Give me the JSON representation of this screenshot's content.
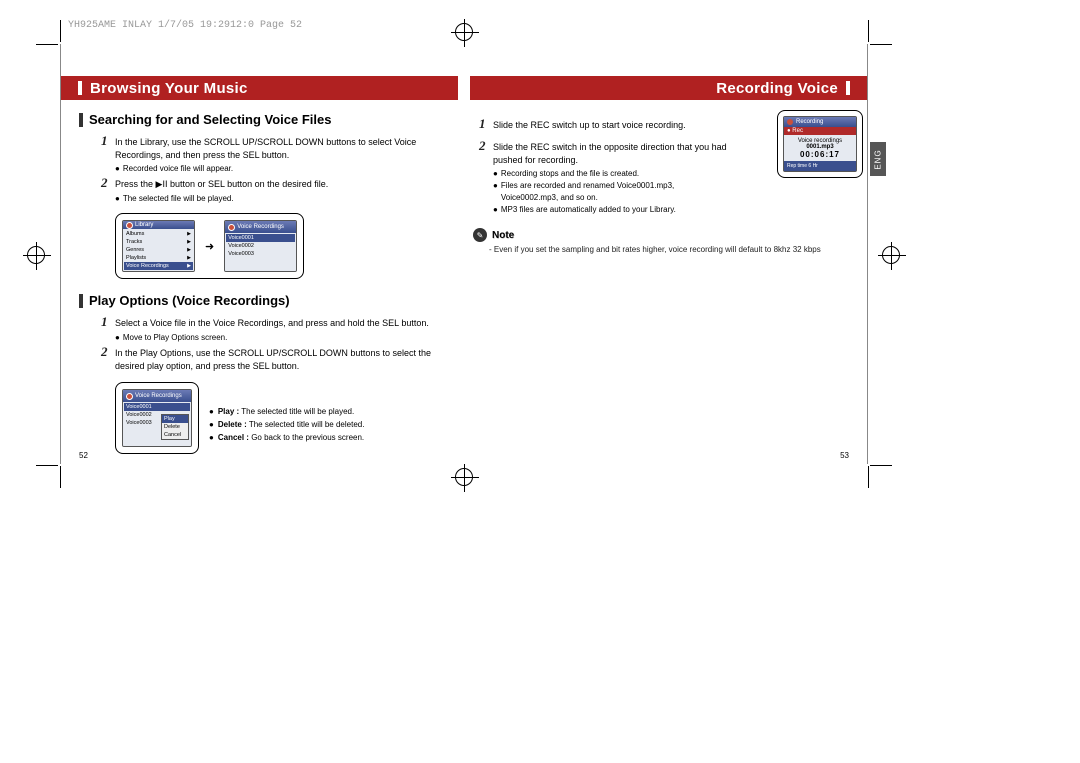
{
  "header_info": "YH925AME INLAY  1/7/05 19:2912:0  Page 52",
  "left": {
    "title": "Browsing Your Music",
    "section1": {
      "title": "Searching for and Selecting Voice Files",
      "step1_num": "1",
      "step1_txt": "In the Library, use the SCROLL UP/SCROLL DOWN buttons to select Voice Recordings, and then press the SEL button.",
      "step1_b1": "Recorded voice file will appear.",
      "step2_num": "2",
      "step2_txt": "Press the ▶II button or SEL button on the desired file.",
      "step2_b1": "The selected file will be played.",
      "lcd1": {
        "title": "Library",
        "rows": [
          "Albums",
          "Tracks",
          "Genres",
          "Playlists"
        ],
        "hl": "Voice Recordings"
      },
      "lcd2": {
        "title": "Voice Recordings",
        "hl": "Voice0001",
        "rows": [
          "Voice0002",
          "Voice0003"
        ]
      }
    },
    "section2": {
      "title": "Play Options (Voice Recordings)",
      "step1_num": "1",
      "step1_txt": "Select a Voice file in the Voice Recordings, and press and hold the SEL button.",
      "step1_b1": "Move to Play Options screen.",
      "step2_num": "2",
      "step2_txt": "In the Play Options, use the SCROLL UP/SCROLL DOWN buttons to select the desired play option, and press the SEL button.",
      "lcd1": {
        "title": "Voice Recordings",
        "hl": "Voice0001",
        "rows": [
          "Voice0002",
          "Voice0003"
        ],
        "popup_hl": "Play",
        "popup_rows": [
          "Delete",
          "Cancel"
        ]
      },
      "opts": {
        "play_l": "Play :",
        "play_t": " The selected title will be played.",
        "delete_l": "Delete :",
        "delete_t": " The selected title will be deleted.",
        "cancel_l": "Cancel :",
        "cancel_t": " Go back to the previous screen."
      }
    },
    "page_num": "52"
  },
  "right": {
    "title": "Recording Voice",
    "lang": "ENG",
    "step1_num": "1",
    "step1_txt": "Slide the REC switch up to start voice recording.",
    "step2_num": "2",
    "step2_txt": "Slide the REC switch in the opposite direction that you had pushed for recording.",
    "b1": "Recording stops and the file is created.",
    "b2": "Files are recorded and renamed Voice0001.mp3, Voice0002.mp3, and so on.",
    "b3": "MP3 files are automatically added to your Library.",
    "lcd": {
      "top": "Recording",
      "rec": "● Rec",
      "l1": "Voice recordings",
      "l2": "0001.mp3",
      "l3": "00:06:17",
      "bot_l": "Rep time 6 Hr",
      "bot_r": ""
    },
    "note": {
      "icon": "✎",
      "label": "Note",
      "text": "- Even if you set the sampling and bit rates higher, voice recording will default to 8khz 32 kbps"
    },
    "page_num": "53"
  }
}
